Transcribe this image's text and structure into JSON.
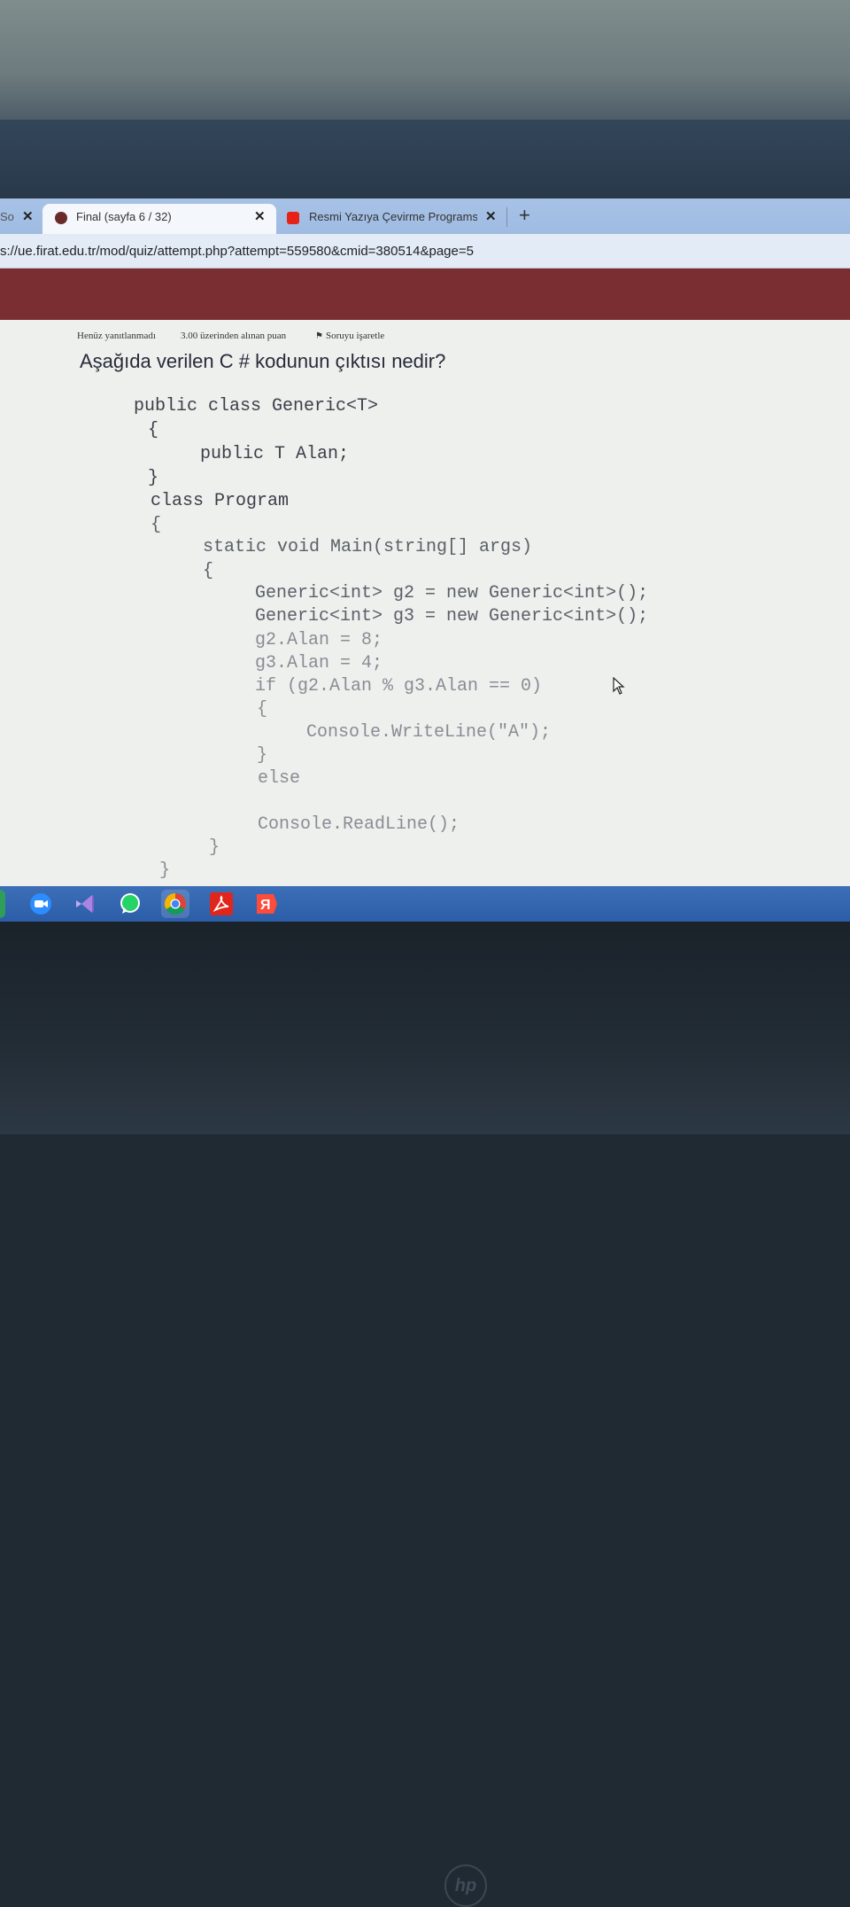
{
  "browser": {
    "tabs": [
      {
        "label": "So",
        "close": "✕",
        "active": false
      },
      {
        "label": "Final (sayfa 6 / 32)",
        "close": "✕",
        "active": true
      },
      {
        "label": "Resmi Yazıya Çevirme Programsız",
        "close": "✕",
        "active": false
      }
    ],
    "new_tab": "+",
    "url": "s://ue.firat.edu.tr/mod/quiz/attempt.php?attempt=559580&cmid=380514&page=5"
  },
  "question": {
    "status": "Henüz yanıtlanmadı",
    "points": "3.00 üzerinden alınan puan",
    "flag_label": "Soruyu işaretle",
    "text": "Aşağıda verilen C # kodunun çıktısı nedir?"
  },
  "code_lines": [
    "public class Generic<T>",
    "{",
    "public T Alan;",
    "}",
    "class Program",
    "{",
    "static void Main(string[] args)",
    "{",
    "Generic<int> g2 = new Generic<int>();",
    "Generic<int> g3 = new Generic<int>();",
    "g2.Alan = 8;",
    "g3.Alan = 4;",
    "if (g2.Alan % g3.Alan == 0)",
    "{",
    "Console.WriteLine(\"A\");",
    "}",
    "else",
    "Console.ReadLine();",
    "}",
    "}"
  ],
  "taskbar": {
    "icons": [
      "zoom-icon",
      "visual-studio-icon",
      "whatsapp-icon",
      "chrome-icon",
      "acrobat-icon",
      "yandex-icon"
    ]
  },
  "colors": {
    "banner": "#7a2e32",
    "taskbar": "#2c5da8",
    "tabbar": "#a7c2e6"
  }
}
